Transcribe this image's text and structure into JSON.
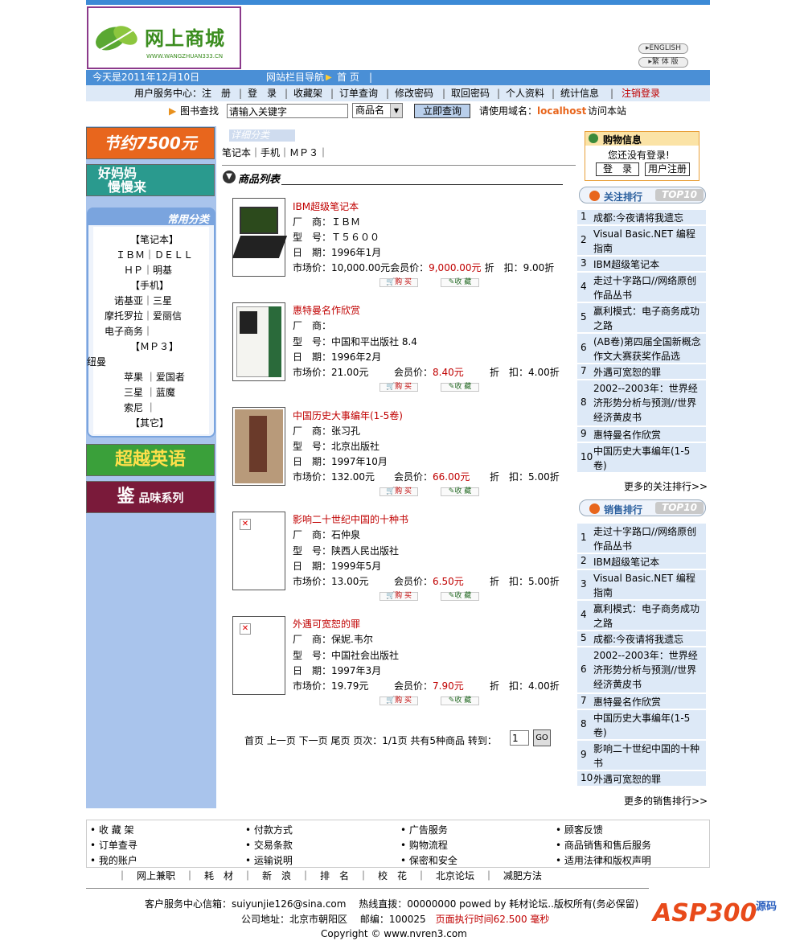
{
  "logo": {
    "main": "网上商城",
    "sub": "WWW.WANGZHUAN333.CN"
  },
  "lang": {
    "english": "ENGLISH",
    "traditional": "繁 体 版"
  },
  "nav": {
    "date": "今天是2011年12月10日",
    "nav_label": "网站栏目导航",
    "home": "首 页",
    "sep": "|"
  },
  "service": {
    "label": "用户服务中心：",
    "items": [
      "注　册",
      "登　录",
      "收藏架",
      "订单查询",
      "修改密码",
      "取回密码",
      "个人资料",
      "统计信息"
    ],
    "logout": "注销登录"
  },
  "search": {
    "label": "图书查找",
    "input_value": "请输入关键字",
    "select_value": "商品名",
    "button": "立即查询",
    "notice_pre": "请使用域名：",
    "domain": "localhost",
    "notice_post": "访问本站"
  },
  "left": {
    "banner1": "节约7500元",
    "banner2_l1": "好妈妈",
    "banner2_l2": "慢慢来",
    "cat_title": "常用分类",
    "cat_lines": [
      "【笔记本】",
      "ＩＢＭ｜ＤＥＬＬ",
      "ＨＰ｜明基",
      "【手机】",
      "诺基亚｜三星",
      "摩托罗拉｜爱丽信",
      "电子商务｜",
      "【ＭＰ３】",
      "纽曼",
      "苹果 ｜爱国者",
      "三星 ｜蓝魔",
      "索尼 ｜",
      "【其它】"
    ],
    "banner3": "超越英语",
    "banner4_l1": "鉴",
    "banner4_l2": "品味系列"
  },
  "detail": {
    "title": "详细分类",
    "links": "笔记本｜手机｜ＭＰ３｜"
  },
  "list_title": "商品列表",
  "product_labels": {
    "maker": "厂　商：",
    "model": "型　号：",
    "date": "日　期：",
    "market": "市场价：",
    "member": "会员价：",
    "discount": "折　扣：",
    "buy": "购 买",
    "fav": "收 藏"
  },
  "products": [
    {
      "name": "IBM超级笔记本",
      "maker": "ＩＢＭ",
      "model": "Ｔ５６００",
      "date": "1996年1月",
      "market": "10,000.00元",
      "member": "9,000.00元",
      "discount": "9.00折"
    },
    {
      "name": "惠特曼名作欣赏",
      "maker": "",
      "model": "中国和平出版社 8.4",
      "date": "1996年2月",
      "market": "21.00元",
      "member": "8.40元",
      "discount": "4.00折"
    },
    {
      "name": "中国历史大事编年(1-5卷)",
      "maker": "张习孔",
      "model": "北京出版社",
      "date": "1997年10月",
      "market": "132.00元",
      "member": "66.00元",
      "discount": "5.00折"
    },
    {
      "name": "影响二十世纪中国的十种书",
      "maker": "石仲泉",
      "model": "陕西人民出版社",
      "date": "1999年5月",
      "market": "13.00元",
      "member": "6.50元",
      "discount": "5.00折"
    },
    {
      "name": "外遇可宽恕的罪",
      "maker": "保妮.韦尔",
      "model": "中国社会出版社",
      "date": "1997年3月",
      "market": "19.79元",
      "member": "7.90元",
      "discount": "4.00折"
    }
  ],
  "pager": {
    "text": "首页 上一页 下一页 尾页 页次：1/1页 共有5种商品 转到：",
    "page": "1",
    "go": "GO"
  },
  "shopinfo": {
    "title": "购物信息",
    "status": "您还没有登录!",
    "login": "登　录",
    "register": "用户注册"
  },
  "attention": {
    "title": "关注排行",
    "badge": "TOP10",
    "more": "更多的关注排行>>",
    "items": [
      "成都:今夜请将我遗忘",
      "Visual Basic.NET 编程指南",
      "IBM超级笔记本",
      "走过十字路口//网络原创作品丛书",
      "赢利模式：电子商务成功之路",
      "(AB卷)第四届全国新概念作文大赛获奖作品选",
      "外遇可宽恕的罪",
      "2002--2003年：世界经济形势分析与预测//世界经济黄皮书",
      "惠特曼名作欣赏",
      "中国历史大事编年(1-5卷)"
    ]
  },
  "sales": {
    "title": "销售排行",
    "badge": "TOP10",
    "more": "更多的销售排行>>",
    "items": [
      "走过十字路口//网络原创作品丛书",
      "IBM超级笔记本",
      "Visual Basic.NET 编程指南",
      "赢利模式：电子商务成功之路",
      "成都:今夜请将我遗忘",
      "2002--2003年：世界经济形势分析与预测//世界经济黄皮书",
      "惠特曼名作欣赏",
      "中国历史大事编年(1-5卷)",
      "影响二十世纪中国的十种书",
      "外遇可宽恕的罪"
    ]
  },
  "footer": {
    "col1": [
      "收 藏 架",
      "订单查寻",
      "我的账户"
    ],
    "col2": [
      "付款方式",
      "交易条款",
      "运输说明"
    ],
    "col3": [
      "广告服务",
      "购物流程",
      "保密和安全"
    ],
    "col4": [
      "顾客反馈",
      "商品销售和售后服务",
      "适用法律和版权声明"
    ],
    "links": "｜　网上兼职　｜　耗　材　｜　新　浪　｜　排　名　｜　校　花　｜　北京论坛　｜　减肥方法",
    "contact": "客户服务中心信箱：suiyunjie126@sina.com　 热线直拨：00000000 powed by 耗材论坛..版权所有(务必保留)",
    "address": "公司地址：北京市朝阳区　 邮编：100025　",
    "exec": "页面执行时间62.500 毫秒",
    "copyright": "Copyright © www.nvren3.com",
    "watermark": "ASP300",
    "watermark2": "源码"
  }
}
